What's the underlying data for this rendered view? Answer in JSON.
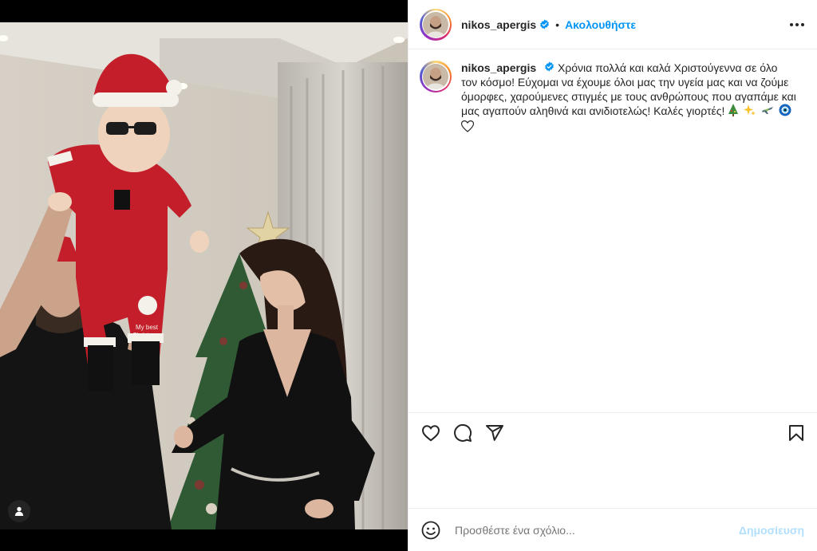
{
  "post": {
    "username": "nikos_apergis",
    "follow_label": "Ακολουθήστε",
    "separator": "•",
    "caption": "Χρόνια πολλά και καλά Χριστούγεννα σε όλο τον κόσμο! Εύχομαι να έχουμε όλοι μας την υγεία μας και να ζούμε όμορφες, χαρούμενες στιγμές με τους ανθρώπους που αγαπάμε και μας αγαπούν αληθινά και ανιδιοτελώς! Καλές γιορτές!",
    "caption_emojis": [
      "christmas-tree",
      "sparkles",
      "airplane",
      "nazar-amulet",
      "white-heart"
    ]
  },
  "comment_box": {
    "placeholder": "Προσθέστε ένα σχόλιο...",
    "post_label": "Δημοσίευση"
  },
  "colors": {
    "accent": "#0095f6",
    "post_disabled": "#b2dffc",
    "text": "#262626",
    "placeholder": "#8e8e8e"
  }
}
